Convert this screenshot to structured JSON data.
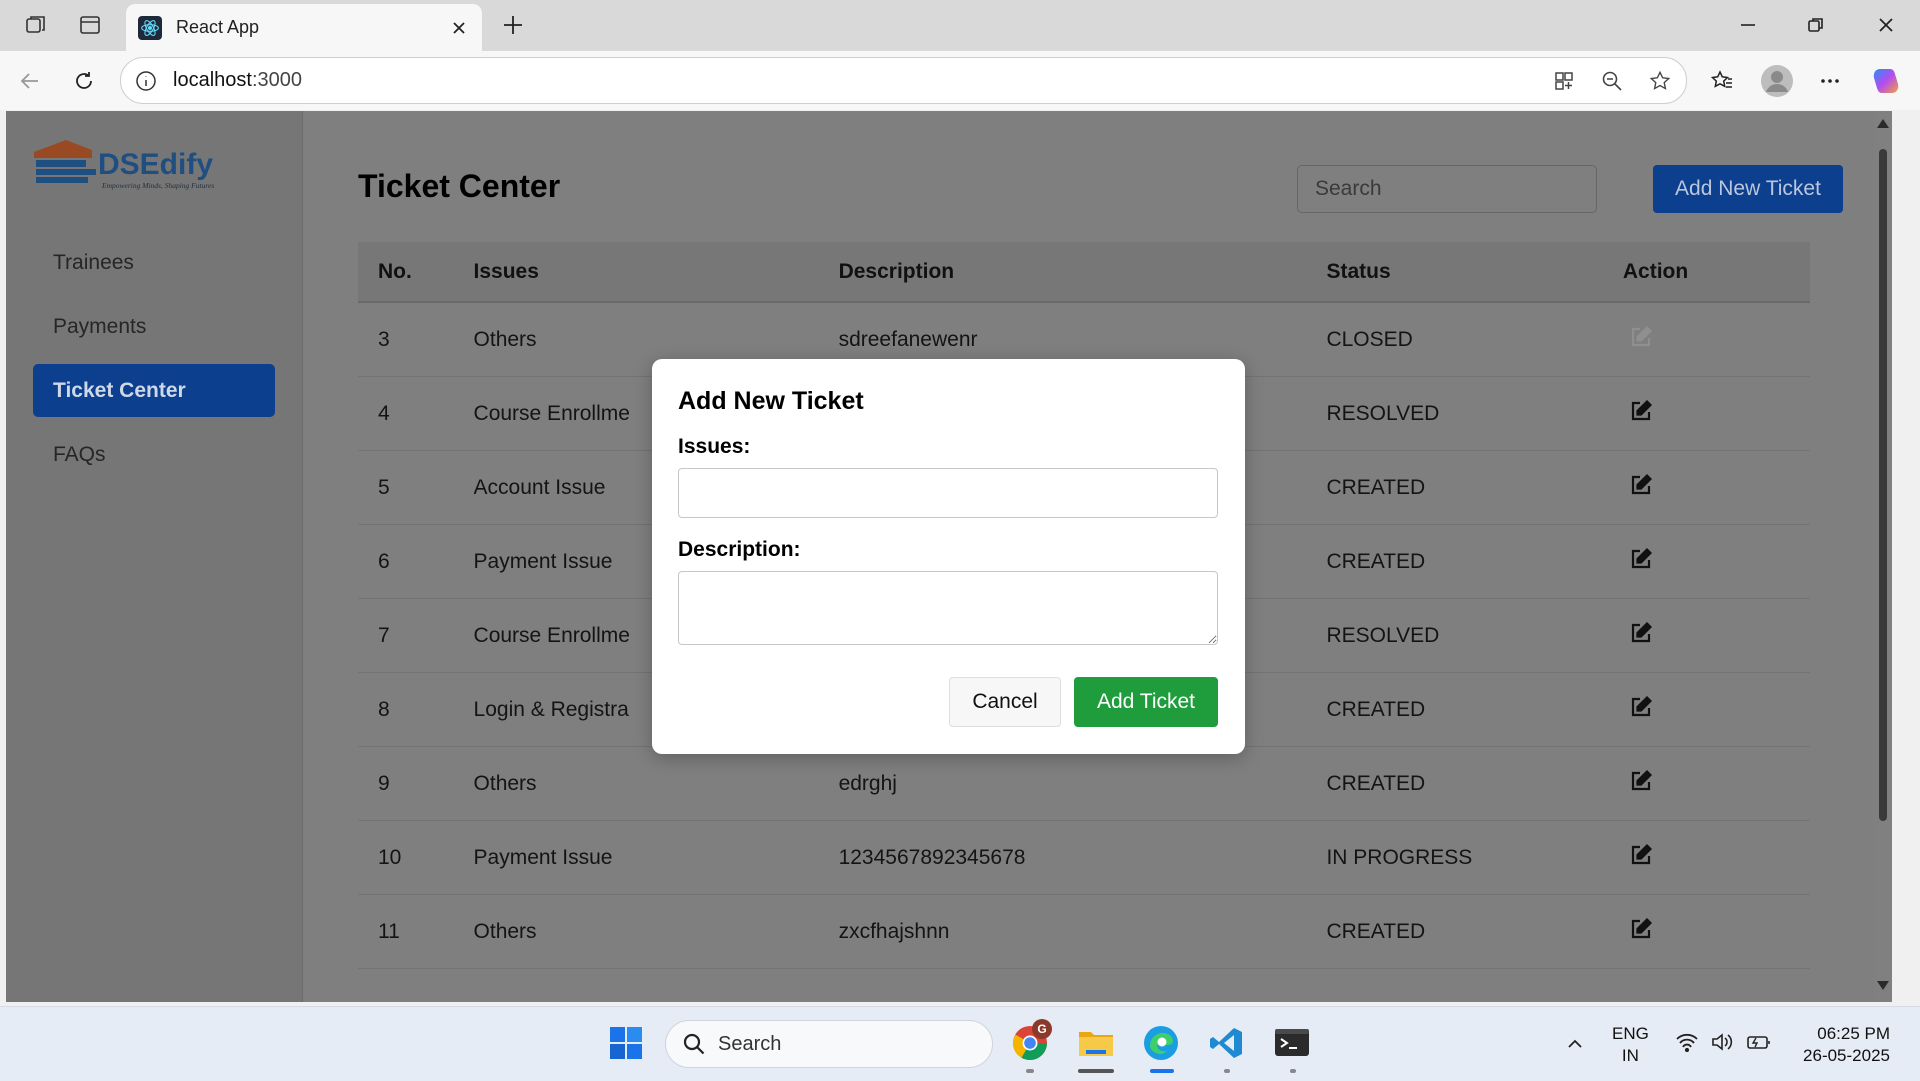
{
  "browser": {
    "tab_title": "React App",
    "url_host": "localhost",
    "url_port": ":3000"
  },
  "sidebar": {
    "logo_text": "DSEdify",
    "logo_tagline": "Empowering Minds, Shaping Futures",
    "items": [
      {
        "label": "Trainees",
        "active": false
      },
      {
        "label": "Payments",
        "active": false
      },
      {
        "label": "Ticket Center",
        "active": true
      },
      {
        "label": "FAQs",
        "active": false
      }
    ]
  },
  "header": {
    "title": "Ticket Center",
    "search_placeholder": "Search",
    "add_button": "Add New Ticket"
  },
  "table": {
    "columns": [
      "No.",
      "Issues",
      "Description",
      "Status",
      "Action"
    ],
    "rows": [
      {
        "no": "3",
        "issue": "Others",
        "description": "sdreefanewenr",
        "status": "CLOSED",
        "edit_disabled": true
      },
      {
        "no": "4",
        "issue": "Course Enrollme",
        "description": "",
        "status": "RESOLVED",
        "edit_disabled": false
      },
      {
        "no": "5",
        "issue": "Account Issue",
        "description": "",
        "status": "CREATED",
        "edit_disabled": false
      },
      {
        "no": "6",
        "issue": "Payment Issue",
        "description": "",
        "status": "CREATED",
        "edit_disabled": false
      },
      {
        "no": "7",
        "issue": "Course Enrollme",
        "description": "",
        "status": "RESOLVED",
        "edit_disabled": false
      },
      {
        "no": "8",
        "issue": "Login & Registra",
        "description": "",
        "status": "CREATED",
        "edit_disabled": false
      },
      {
        "no": "9",
        "issue": "Others",
        "description": "edrghj",
        "status": "CREATED",
        "edit_disabled": false
      },
      {
        "no": "10",
        "issue": "Payment Issue",
        "description": "1234567892345678",
        "status": "IN PROGRESS",
        "edit_disabled": false
      },
      {
        "no": "11",
        "issue": "Others",
        "description": "zxcfhajshnn",
        "status": "CREATED",
        "edit_disabled": false
      }
    ]
  },
  "modal": {
    "title": "Add New Ticket",
    "issues_label": "Issues:",
    "issues_value": "",
    "description_label": "Description:",
    "description_value": "",
    "cancel_label": "Cancel",
    "submit_label": "Add Ticket"
  },
  "taskbar": {
    "search_label": "Search",
    "chrome_badge": "G",
    "lang_line1": "ENG",
    "lang_line2": "IN",
    "time": "06:25 PM",
    "date": "26-05-2025"
  },
  "colors": {
    "primary": "#0d3f8f",
    "success": "#1f9d3c",
    "overlay_bg": "#7f7f7f"
  }
}
